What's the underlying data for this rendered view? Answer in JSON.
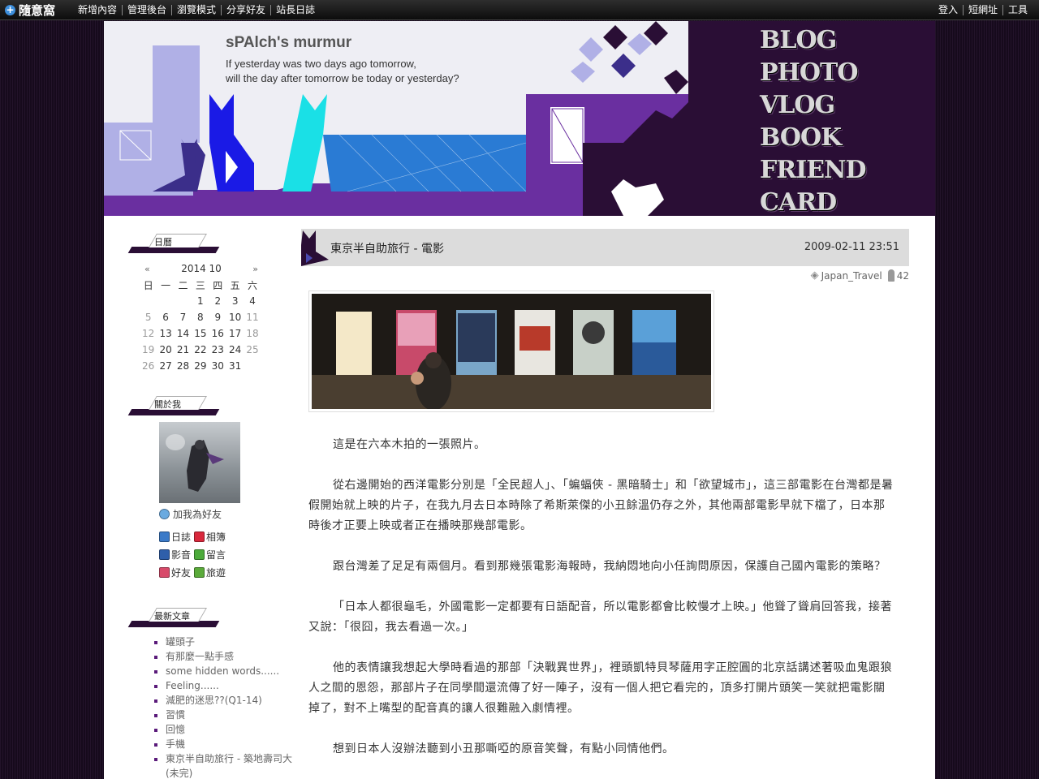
{
  "topbar": {
    "brand": "隨意窩",
    "left_links": [
      "新增內容",
      "管理後台",
      "瀏覽模式",
      "分享好友",
      "站長日誌"
    ],
    "right_links": [
      "登入",
      "短網址",
      "工具"
    ]
  },
  "banner": {
    "title": "sPAlch's murmur",
    "subtitle_line1": "If yesterday was two days ago tomorrow,",
    "subtitle_line2": "will the day after tomorrow be today or yesterday?",
    "menu": [
      "BLOG",
      "PHOTO",
      "VLOG",
      "BOOK",
      "FRIEND",
      "CARD"
    ]
  },
  "sidebar": {
    "calendar": {
      "heading": "日曆",
      "prev": "«",
      "next": "»",
      "month": "2014 10",
      "weekdays": [
        "日",
        "一",
        "二",
        "三",
        "四",
        "五",
        "六"
      ],
      "weeks": [
        [
          "",
          "",
          "",
          "1",
          "2",
          "3",
          "4"
        ],
        [
          "5",
          "6",
          "7",
          "8",
          "9",
          "10",
          "11"
        ],
        [
          "12",
          "13",
          "14",
          "15",
          "16",
          "17",
          "18"
        ],
        [
          "19",
          "20",
          "21",
          "22",
          "23",
          "24",
          "25"
        ],
        [
          "26",
          "27",
          "28",
          "29",
          "30",
          "31",
          ""
        ]
      ]
    },
    "about": {
      "heading": "關於我",
      "add_friend": "加我為好友",
      "links": [
        {
          "label": "日誌",
          "icon": "diary-icon",
          "color": "#3a7ac8"
        },
        {
          "label": "相簿",
          "icon": "album-icon",
          "color": "#d8283c"
        },
        {
          "label": "影音",
          "icon": "video-icon",
          "color": "#2f5faa"
        },
        {
          "label": "留言",
          "icon": "message-icon",
          "color": "#4caa3a"
        },
        {
          "label": "好友",
          "icon": "friends-icon",
          "color": "#d84a6a"
        },
        {
          "label": "旅遊",
          "icon": "travel-icon",
          "color": "#5aaa3a"
        }
      ]
    },
    "recent": {
      "heading": "最新文章",
      "items": [
        "罐頭子",
        "有那麼一點手感",
        "some hidden words......",
        "Feeling......",
        "減肥的迷思??(Q1-14)",
        "習慣",
        "回憶",
        "手機",
        "東京半自助旅行 - 築地壽司大",
        "(未完)"
      ]
    }
  },
  "post": {
    "title": "東京半自助旅行 - 電影",
    "date": "2009-02-11 23:51",
    "category": "Japan_Travel",
    "views": "42",
    "paragraphs": [
      "這是在六本木拍的一張照片。",
      "從右邊開始的西洋電影分別是「全民超人」、「蝙蝠俠 - 黑暗騎士」和「欲望城市」，這三部電影在台灣都是暑假開始就上映的片子，在我九月去日本時除了希斯萊傑的小丑餘溫仍存之外，其他兩部電影早就下檔了，日本那時後才正要上映或者正在播映那幾部電影。",
      "跟台灣差了足足有兩個月。看到那幾張電影海報時，我納悶地向小任詢問原因，保護自己國內電影的策略？",
      "「日本人都很龜毛，外國電影一定都要有日語配音，所以電影都會比較慢才上映。」他聳了聳肩回答我，接著又說：「很囧，我去看過一次。」",
      "他的表情讓我想起大學時看過的那部「決戰異世界」，裡頭凱特貝琴薩用字正腔圓的北京話講述著吸血鬼跟狼人之間的恩怨，那部片子在同學間還流傳了好一陣子，沒有一個人把它看完的，頂多打開片頭笑一笑就把電影關掉了，對不上嘴型的配音真的讓人很難融入劇情裡。",
      "想到日本人沒辦法聽到小丑那嘶啞的原音笑聲，有點小同情他們。"
    ]
  },
  "colors": {
    "page_bg": "#160a1c",
    "banner_purple_dark": "#2a0e35",
    "banner_purple": "#6a2fa0",
    "banner_lavender": "#b0b0e6",
    "banner_blue": "#1a1ae6",
    "banner_cyan": "#1ae0e6"
  }
}
